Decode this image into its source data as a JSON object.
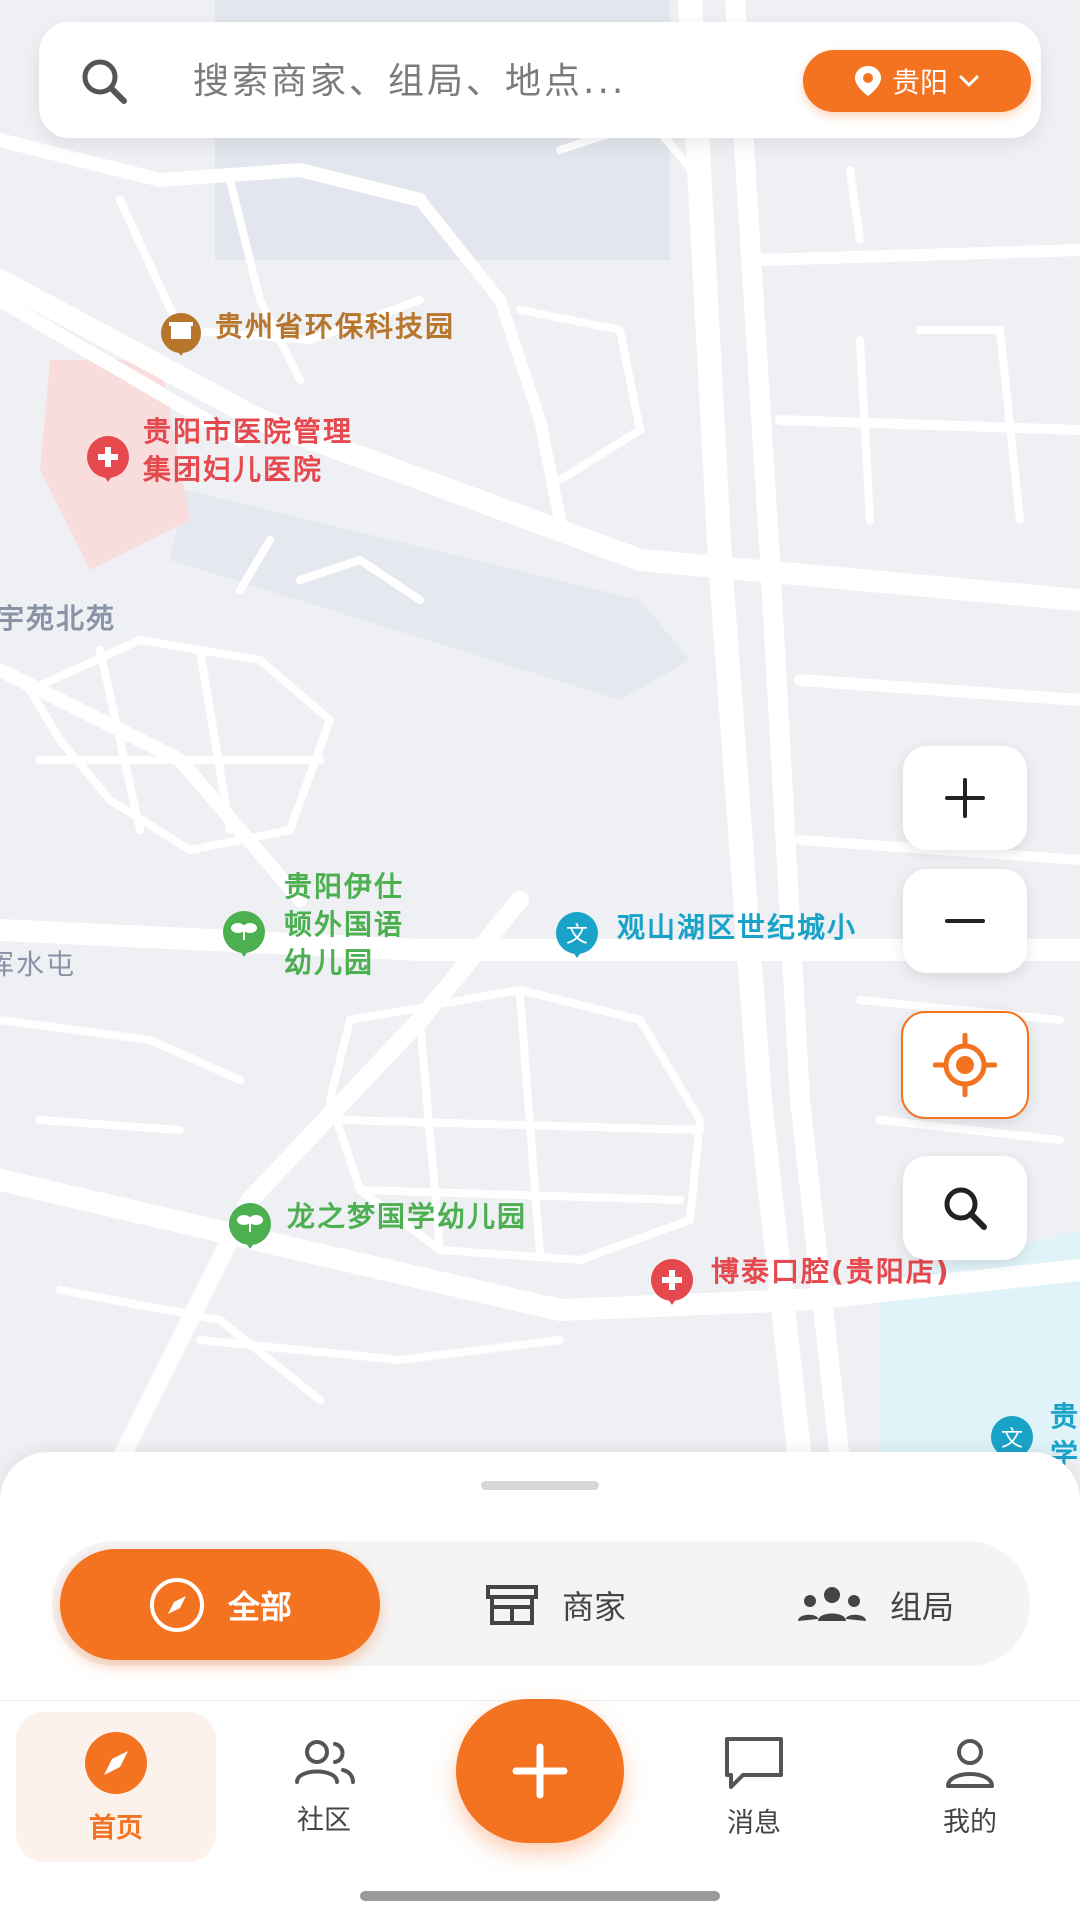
{
  "search": {
    "placeholder": "搜索商家、组局、地点..."
  },
  "city": {
    "label": "贵阳"
  },
  "map_labels": {
    "poi_park": "贵州省环保科技园",
    "poi_hospital_line1": "贵阳市医院管理",
    "poi_hospital_line2": "集团妇儿医院",
    "poi_area_north": "宇苑北苑",
    "poi_school_line1": "贵阳伊仕",
    "poi_school_line2": "顿外国语",
    "poi_school_line3": "幼儿园",
    "poi_water": "浑水屯",
    "poi_edu": "观山湖区世纪城小",
    "poi_kinder": "龙之梦国学幼儿园",
    "poi_dental": "博泰口腔(贵阳店)",
    "poi_edge_line1": "贵",
    "poi_edge_line2": "学"
  },
  "segments": {
    "all": "全部",
    "merchant": "商家",
    "group": "组局"
  },
  "nav": {
    "home": "首页",
    "community": "社区",
    "messages": "消息",
    "mine": "我的"
  },
  "colors": {
    "accent": "#f47321",
    "map_bg": "#eef0f4",
    "road": "#ffffff",
    "green_poi": "#4caf50",
    "red_poi": "#e5484d",
    "brown_poi": "#b8752c",
    "teal_poi": "#1aa3c8"
  }
}
